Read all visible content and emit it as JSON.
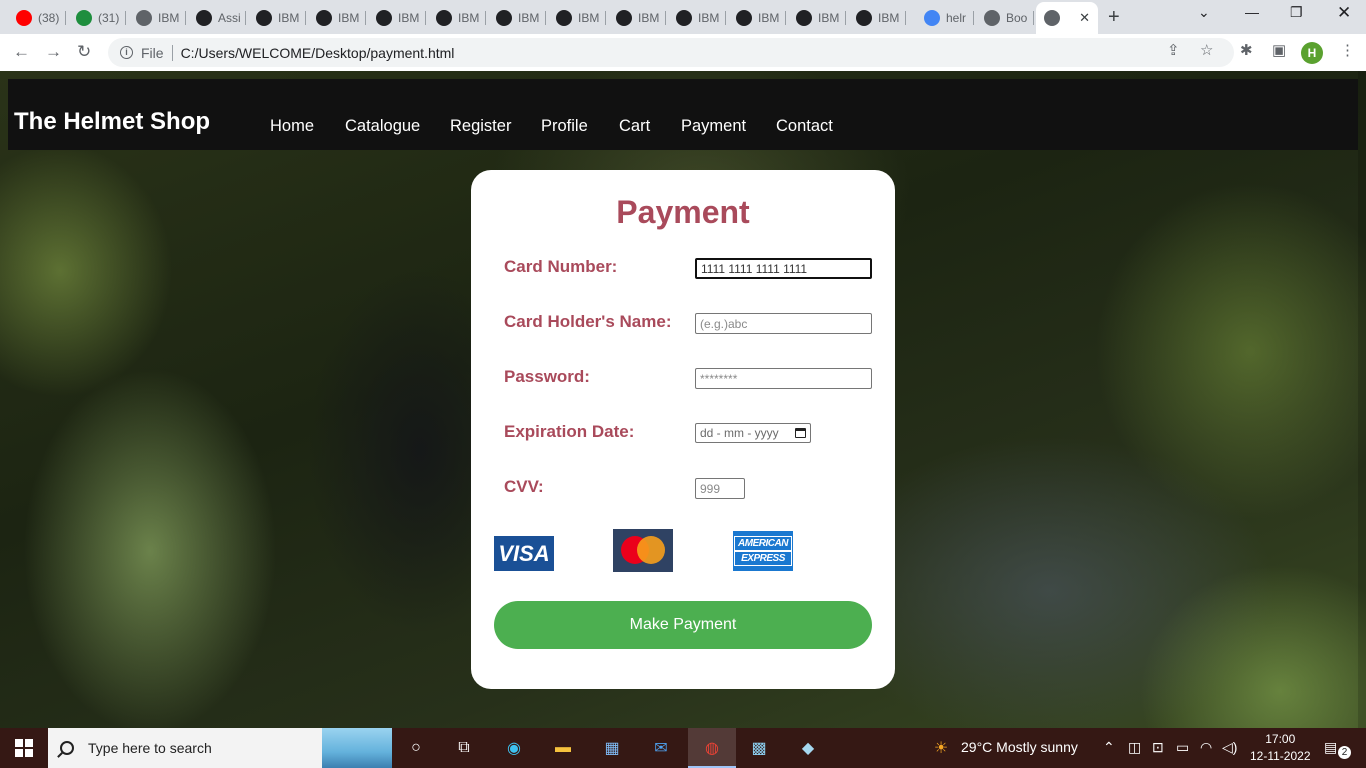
{
  "browser": {
    "tabs": [
      {
        "title": "(38)",
        "icon": "youtube-icon",
        "color": "#ff0000"
      },
      {
        "title": "(31)",
        "icon": "calendar-icon",
        "color": "#1e8e3e"
      },
      {
        "title": "IBM",
        "icon": "globe-icon",
        "color": "#5f6368"
      },
      {
        "title": "Assi",
        "icon": "github-icon",
        "color": "#202124"
      },
      {
        "title": "IBM",
        "icon": "github-icon",
        "color": "#202124"
      },
      {
        "title": "IBM",
        "icon": "github-icon",
        "color": "#202124"
      },
      {
        "title": "IBM",
        "icon": "github-icon",
        "color": "#202124"
      },
      {
        "title": "IBM",
        "icon": "github-icon",
        "color": "#202124"
      },
      {
        "title": "IBM",
        "icon": "github-icon",
        "color": "#202124"
      },
      {
        "title": "IBM",
        "icon": "github-icon",
        "color": "#202124"
      },
      {
        "title": "IBM",
        "icon": "github-icon",
        "color": "#202124"
      },
      {
        "title": "IBM",
        "icon": "github-icon",
        "color": "#202124"
      },
      {
        "title": "IBM",
        "icon": "github-icon",
        "color": "#202124"
      },
      {
        "title": "IBM",
        "icon": "github-icon",
        "color": "#202124"
      },
      {
        "title": "IBM",
        "icon": "github-icon",
        "color": "#202124"
      },
      {
        "title": "helr",
        "icon": "google-icon",
        "color": "#4285f4"
      },
      {
        "title": "Boo",
        "icon": "globe-icon",
        "color": "#5f6368"
      },
      {
        "title": "",
        "icon": "globe-icon",
        "color": "#5f6368",
        "active": true
      }
    ],
    "address": {
      "scheme_label": "File",
      "url": "C:/Users/WELCOME/Desktop/payment.html"
    },
    "profile_initial": "H"
  },
  "site": {
    "brand": "The Helmet Shop",
    "nav": [
      "Home",
      "Catalogue",
      "Register",
      "Profile",
      "Cart",
      "Payment",
      "Contact"
    ]
  },
  "payment": {
    "title": "Payment",
    "card_number": {
      "label": "Card Number:",
      "value": "1111 1111 1111 1111"
    },
    "holder_name": {
      "label": "Card Holder's Name:",
      "placeholder": "(e.g.)abc"
    },
    "password": {
      "label": "Password:",
      "placeholder": "********"
    },
    "expiration": {
      "label": "Expiration Date:",
      "placeholder": "dd - mm - yyyy"
    },
    "cvv": {
      "label": "CVV:",
      "placeholder": "999"
    },
    "card_logos": {
      "visa": "VISA",
      "mastercard": "mastercard-logo",
      "amex_line1": "AMERICAN",
      "amex_line2": "EXPRESS"
    },
    "submit_label": "Make Payment",
    "accent_color": "#a94a5b",
    "button_color": "#4caf50"
  },
  "taskbar": {
    "search_placeholder": "Type here to search",
    "weather": "29°C  Mostly sunny",
    "time": "17:00",
    "date": "12-11-2022",
    "notifications": "2"
  }
}
